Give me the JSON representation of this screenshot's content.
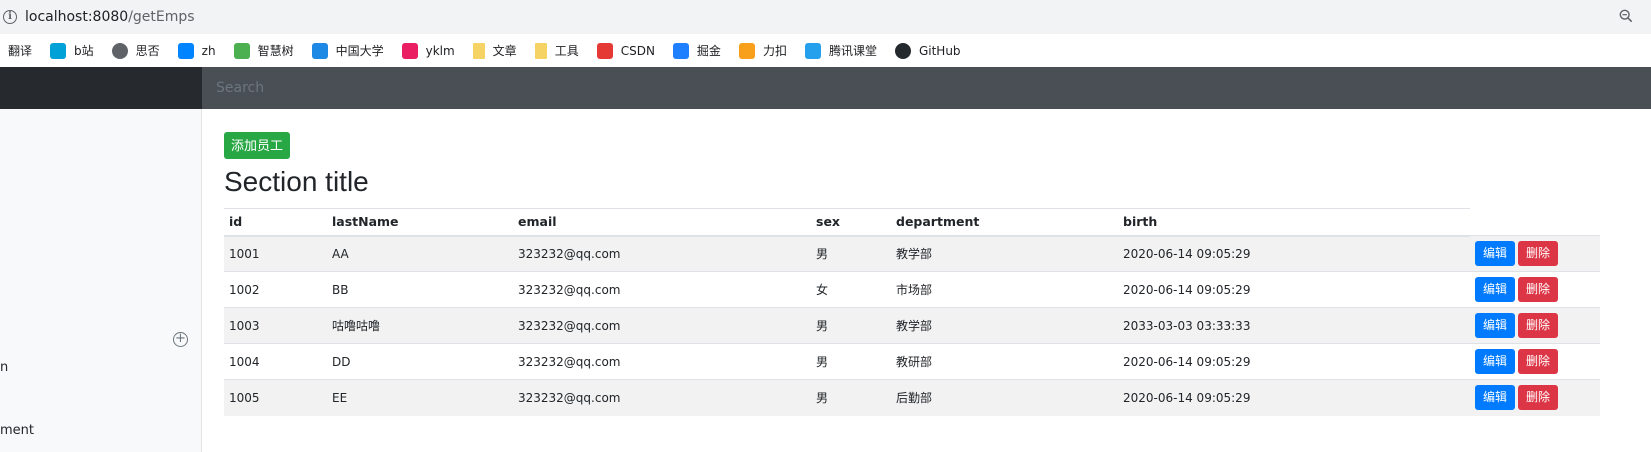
{
  "browser": {
    "url_host": "localhost:8080",
    "url_path": "/getEmps",
    "bookmarks": [
      {
        "label": "翻译",
        "icon": "none",
        "color": "#ffffff"
      },
      {
        "label": "b站",
        "icon": "bilibili-icon",
        "color": "#00a1d6"
      },
      {
        "label": "思否",
        "icon": "globe-icon",
        "color": "#5f6368"
      },
      {
        "label": "zh",
        "icon": "zhihu-icon",
        "color": "#0084ff"
      },
      {
        "label": "智慧树",
        "icon": "tree-icon",
        "color": "#4caf50"
      },
      {
        "label": "中国大学",
        "icon": "book-icon",
        "color": "#1e88e5"
      },
      {
        "label": "yklm",
        "icon": "yklm-icon",
        "color": "#e91e63"
      },
      {
        "label": "文章",
        "icon": "folder-icon",
        "color": "#f6d365"
      },
      {
        "label": "工具",
        "icon": "folder-icon",
        "color": "#f6d365"
      },
      {
        "label": "CSDN",
        "icon": "csdn-icon",
        "color": "#e53935"
      },
      {
        "label": "掘金",
        "icon": "juejin-icon",
        "color": "#1e80ff"
      },
      {
        "label": "力扣",
        "icon": "leetcode-icon",
        "color": "#f89f1b"
      },
      {
        "label": "腾讯课堂",
        "icon": "tencent-class-icon",
        "color": "#24a0ed"
      },
      {
        "label": "GitHub",
        "icon": "github-icon",
        "color": "#24292e"
      }
    ]
  },
  "navbar": {
    "search_placeholder": "Search"
  },
  "sidebar": {
    "fragment_1": "n",
    "fragment_2": "ment"
  },
  "main": {
    "add_button": "添加员工",
    "section_title": "Section title",
    "columns": [
      "id",
      "lastName",
      "email",
      "sex",
      "department",
      "birth"
    ],
    "edit_label": "编辑",
    "delete_label": "删除",
    "rows": [
      [
        "1001",
        "AA",
        "323232@qq.com",
        "男",
        "教学部",
        "2020-06-14 09:05:29"
      ],
      [
        "1002",
        "BB",
        "323232@qq.com",
        "女",
        "市场部",
        "2020-06-14 09:05:29"
      ],
      [
        "1003",
        "咕噜咕噜",
        "323232@qq.com",
        "男",
        "教学部",
        "2033-03-03 03:33:33"
      ],
      [
        "1004",
        "DD",
        "323232@qq.com",
        "男",
        "教研部",
        "2020-06-14 09:05:29"
      ],
      [
        "1005",
        "EE",
        "323232@qq.com",
        "男",
        "后勤部",
        "2020-06-14 09:05:29"
      ]
    ]
  },
  "colors": {
    "success": "#28a745",
    "primary": "#007bff",
    "danger": "#dc3545",
    "navbar": "#343a40"
  }
}
